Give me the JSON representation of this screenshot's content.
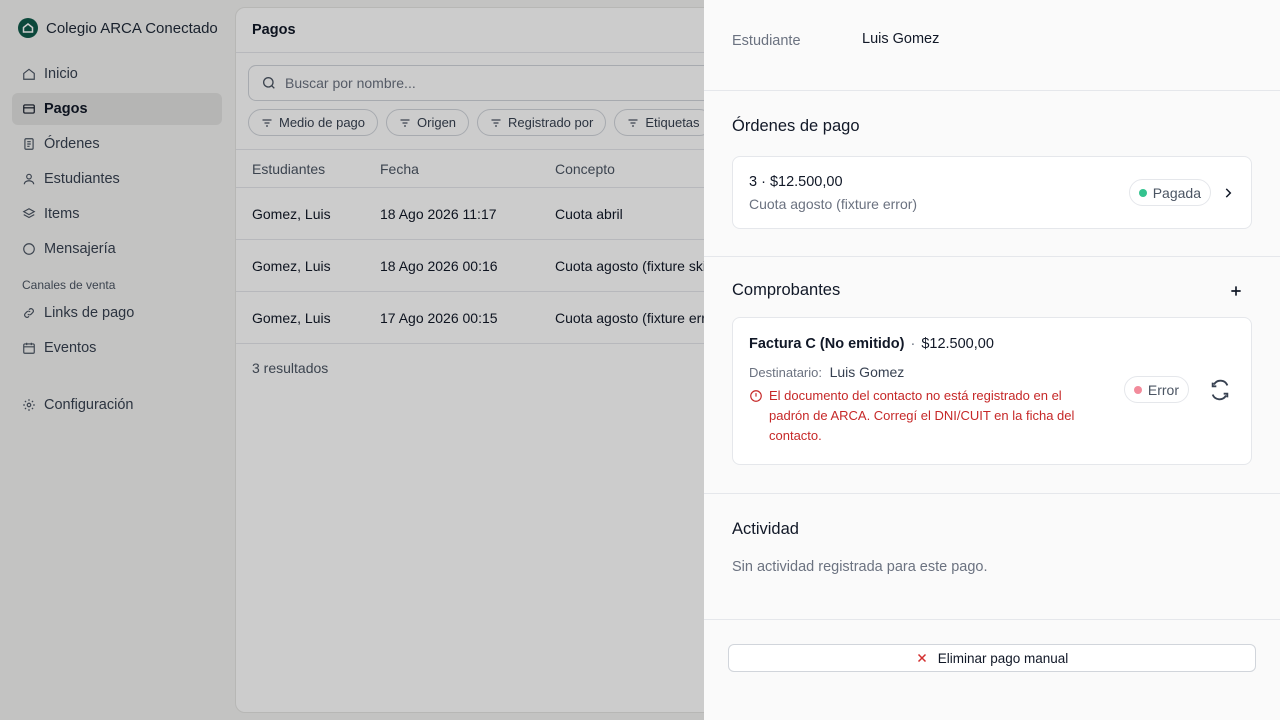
{
  "app": {
    "name": "Colegio ARCA Conectado"
  },
  "sidebar": {
    "items": [
      {
        "label": "Inicio",
        "icon": "home-icon"
      },
      {
        "label": "Pagos",
        "icon": "wallet-icon",
        "active": true
      },
      {
        "label": "Órdenes",
        "icon": "file-icon"
      },
      {
        "label": "Estudiantes",
        "icon": "user-icon"
      },
      {
        "label": "Items",
        "icon": "layers-icon"
      },
      {
        "label": "Mensajería",
        "icon": "message-icon"
      }
    ],
    "section_label": "Canales de venta",
    "sales_items": [
      {
        "label": "Links de pago",
        "icon": "link-icon"
      },
      {
        "label": "Eventos",
        "icon": "calendar-icon"
      }
    ],
    "settings_label": "Configuración"
  },
  "main": {
    "title": "Pagos",
    "search_placeholder": "Buscar por nombre...",
    "filters": [
      "Medio de pago",
      "Origen",
      "Registrado por",
      "Etiquetas"
    ],
    "columns": [
      "Estudiantes",
      "Fecha",
      "Concepto"
    ],
    "rows": [
      [
        "Gomez, Luis",
        "18 Ago 2026 11:17",
        "Cuota abril"
      ],
      [
        "Gomez, Luis",
        "18 Ago 2026 00:16",
        "Cuota agosto (fixture skip)"
      ],
      [
        "Gomez, Luis",
        "17 Ago 2026 00:15",
        "Cuota agosto (fixture error)"
      ]
    ],
    "results": "3 resultados"
  },
  "drawer": {
    "student_label": "Estudiante",
    "student_value": "Luis Gomez",
    "orders_title": "Órdenes de pago",
    "order": {
      "line1": "3 · $12.500,00",
      "line2": "Cuota agosto (fixture error)",
      "status": "Pagada",
      "status_color": "#34c38f"
    },
    "receipts_title": "Comprobantes",
    "invoice": {
      "type": "Factura C (No emitido)",
      "separator": "·",
      "amount": "$12.500,00",
      "recipient_label": "Destinatario:",
      "recipient_value": "Luis Gomez",
      "error_message": "El documento del contacto no está registrado en el padrón de ARCA. Corregí el DNI/CUIT en la ficha del contacto.",
      "status": "Error",
      "status_color": "#f28b9b"
    },
    "activity_title": "Actividad",
    "activity_empty": "Sin actividad registrada para este pago.",
    "delete_label": "Eliminar pago manual"
  }
}
